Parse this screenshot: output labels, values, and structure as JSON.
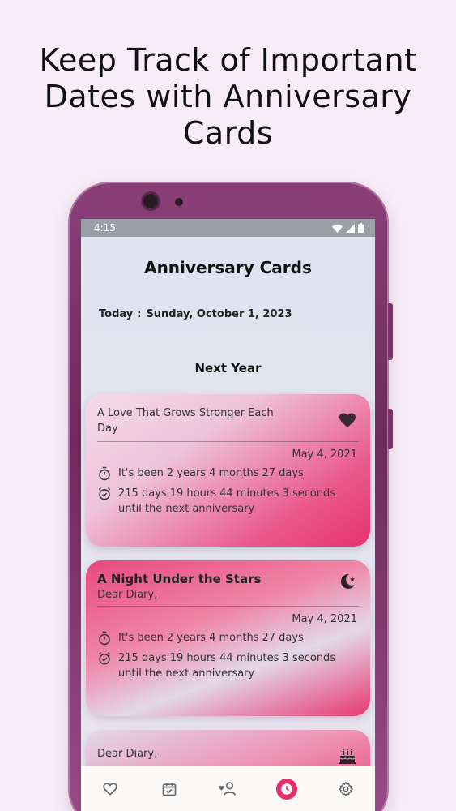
{
  "headline": {
    "line1": "Keep Track of Important",
    "line2": "Dates with Anniversary",
    "line3": "Cards"
  },
  "status_bar": {
    "time": "4:15"
  },
  "app": {
    "title": "Anniversary Cards",
    "today_label": "Today",
    "today_sep": ":",
    "today_value": "Sunday, October 1, 2023",
    "section_label": "Next Year"
  },
  "cards": [
    {
      "title": "A Love That Grows Stronger Each Day",
      "subtitle": "",
      "icon": "heart-icon",
      "date": "May 4, 2021",
      "elapsed": {
        "prefix": "It's been",
        "years": "2 years",
        "months": "4 months",
        "days": "27 days"
      },
      "countdown": {
        "line1": "215 days 19 hours 44 minutes 3 seconds",
        "line2": "until the next anniversary"
      }
    },
    {
      "title": "A Night Under the Stars",
      "subtitle": "Dear Diary,",
      "icon": "moon-star-icon",
      "date": "May 4, 2021",
      "elapsed": {
        "prefix": "It's been",
        "years": "2 years",
        "months": "4 months",
        "days": "27 days"
      },
      "countdown": {
        "line1": "215 days 19 hours 44 minutes 3 seconds",
        "line2": "until the next anniversary"
      }
    },
    {
      "title": "",
      "subtitle": "Dear Diary,",
      "icon": "cake-icon"
    }
  ],
  "bottom_nav": [
    {
      "icon": "heart-outline-icon",
      "active": false
    },
    {
      "icon": "calendar-check-icon",
      "active": false
    },
    {
      "icon": "user-heart-icon",
      "active": false
    },
    {
      "icon": "clock-icon",
      "active": true
    },
    {
      "icon": "gear-icon",
      "active": false
    }
  ],
  "colors": {
    "accent": "#e7306d",
    "phone_frame": "#7a3169",
    "page_bg": "#f8ecf6"
  }
}
